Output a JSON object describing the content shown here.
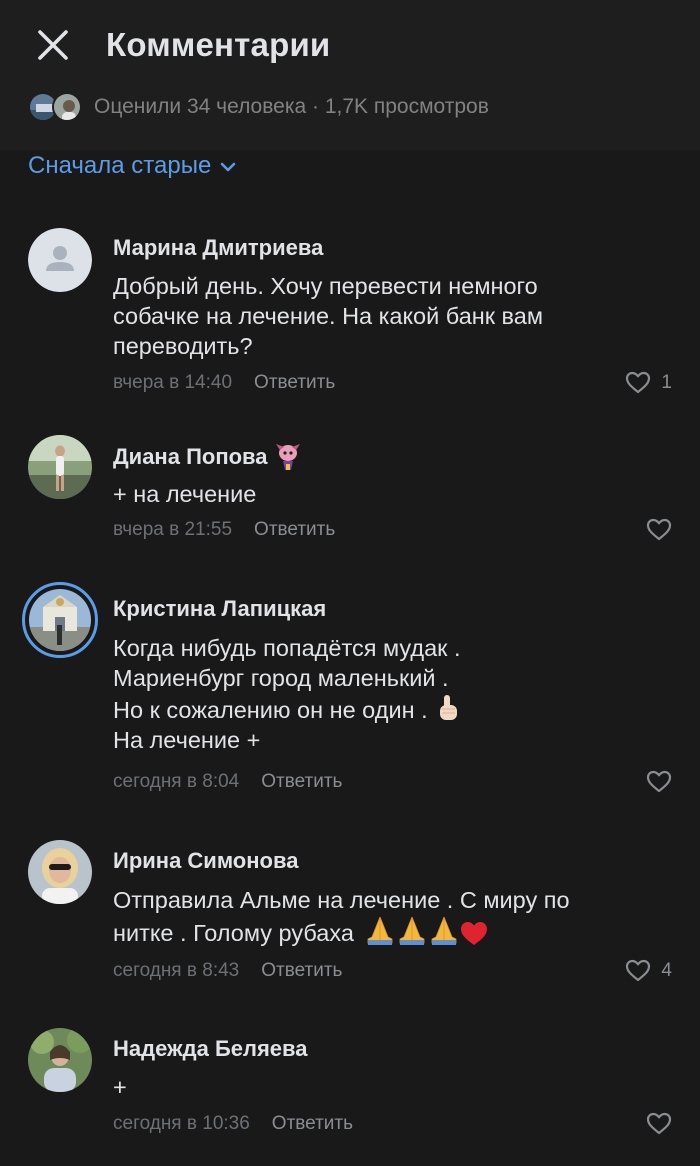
{
  "header": {
    "title": "Комментарии",
    "stats": "Оценили 34 человека · 1,7K просмотров"
  },
  "sort": {
    "label": "Сначала старые"
  },
  "reply_label": "Ответить",
  "comments": [
    {
      "author": "Марина Дмитриева",
      "text": [
        "Добрый день. Хочу перевести немного",
        "собачке на лечение. На какой банк вам",
        "переводить?"
      ],
      "time": "вчера в 14:40",
      "likes": "1"
    },
    {
      "author": "Диана Попова",
      "text": [
        "+ на лечение"
      ],
      "time": "вчера в 21:55",
      "likes": ""
    },
    {
      "author": "Кристина Лапицкая",
      "text": [
        "Когда нибудь попадётся мудак .",
        "Мариенбург город маленький .",
        "Но к сожалению он не один .",
        "На лечение +"
      ],
      "time": "сегодня в 8:04",
      "likes": ""
    },
    {
      "author": "Ирина Симонова",
      "text": [
        "Отправила Альме на лечение . С миру по",
        "нитке . Голому рубаха"
      ],
      "time": "сегодня в 8:43",
      "likes": "4"
    },
    {
      "author": "Надежда Беляева",
      "text": [
        "+"
      ],
      "time": "сегодня в 10:36",
      "likes": ""
    }
  ],
  "colors": {
    "background": "#19191a",
    "header": "#1e1e1f",
    "accent": "#5c9ce6",
    "text": "#e1e3e6",
    "secondary": "#828282"
  },
  "icons": [
    "close-icon",
    "chevron-down-icon",
    "heart-icon",
    "default-avatar-icon",
    "pointing-up-emoji",
    "praying-hands-emoji",
    "red-heart-emoji"
  ]
}
